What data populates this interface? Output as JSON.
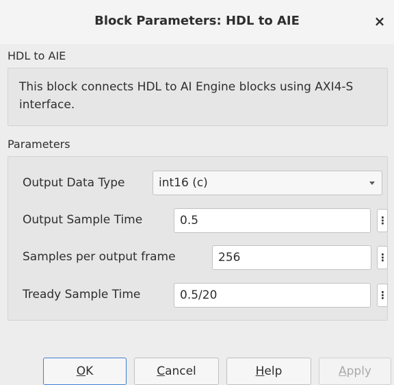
{
  "window": {
    "title": "Block Parameters: HDL to AIE",
    "close_glyph": "×"
  },
  "block": {
    "heading": "HDL to AIE",
    "description": "This block connects HDL to AI Engine blocks using AXI4-S interface."
  },
  "parameters": {
    "heading": "Parameters",
    "output_data_type": {
      "label": "Output Data Type",
      "value": "int16 (c)"
    },
    "output_sample_time": {
      "label": "Output Sample Time",
      "value": "0.5"
    },
    "samples_per_output_frame": {
      "label": "Samples per output frame",
      "value": "256"
    },
    "tready_sample_time": {
      "label": "Tready Sample Time",
      "value": "0.5/20"
    },
    "menu_glyph": "⋮"
  },
  "buttons": {
    "ok": {
      "mnemonic": "O",
      "rest": "K"
    },
    "cancel": {
      "mnemonic": "C",
      "rest": "ancel"
    },
    "help": {
      "mnemonic": "H",
      "rest": "elp"
    },
    "apply": {
      "mnemonic": "A",
      "rest": "pply"
    }
  },
  "colors": {
    "default_button_border": "#3e7fd0",
    "background": "#ededed"
  }
}
